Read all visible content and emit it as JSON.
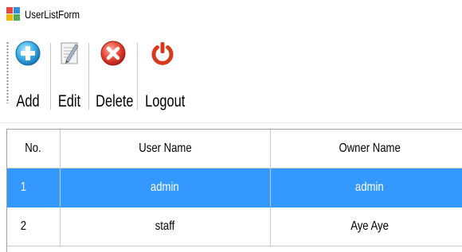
{
  "window": {
    "title": "UserListForm"
  },
  "toolbar": {
    "buttons": [
      {
        "label": "Add",
        "icon": "add-icon"
      },
      {
        "label": "Edit",
        "icon": "edit-icon"
      },
      {
        "label": "Delete",
        "icon": "delete-icon"
      },
      {
        "label": "Logout",
        "icon": "logout-icon"
      }
    ]
  },
  "grid": {
    "columns": [
      "No.",
      "User Name",
      "Owner Name"
    ],
    "rows": [
      {
        "no": "1",
        "user_name": "admin",
        "owner_name": "admin",
        "selected": true
      },
      {
        "no": "2",
        "user_name": "staff",
        "owner_name": "Aye Aye",
        "selected": false
      }
    ]
  },
  "colors": {
    "selection": "#3399ff",
    "add_icon": "#2aa3e0",
    "delete_icon": "#e0362a",
    "logout_icon": "#e34a1f"
  }
}
